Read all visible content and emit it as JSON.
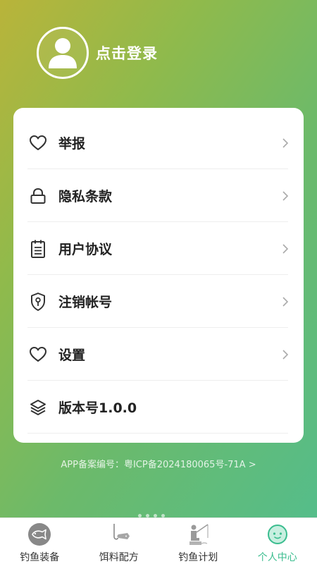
{
  "user": {
    "login_text": "点击登录"
  },
  "menu": {
    "items": [
      {
        "label": "举报",
        "icon": "heart-icon"
      },
      {
        "label": "隐私条款",
        "icon": "lock-icon"
      },
      {
        "label": "用户协议",
        "icon": "notepad-icon"
      },
      {
        "label": "注销帐号",
        "icon": "shield-key-icon"
      },
      {
        "label": "设置",
        "icon": "heart-icon"
      },
      {
        "label": "版本号1.0.0",
        "icon": "layers-icon"
      }
    ]
  },
  "footer": {
    "filing_text": "APP备案编号：粤ICP备2024180065号-71A >"
  },
  "tabbar": {
    "tabs": [
      {
        "label": "钓鱼装备",
        "icon": "fish-icon",
        "active": false
      },
      {
        "label": "饵料配方",
        "icon": "hook-bait-icon",
        "active": false
      },
      {
        "label": "钓鱼计划",
        "icon": "angler-icon",
        "active": false
      },
      {
        "label": "个人中心",
        "icon": "face-icon",
        "active": true
      }
    ]
  },
  "colors": {
    "gradient_start": "#b9b43a",
    "gradient_end": "#55bd8a",
    "active_tab": "#3bbd8f",
    "card_bg": "#ffffff"
  }
}
